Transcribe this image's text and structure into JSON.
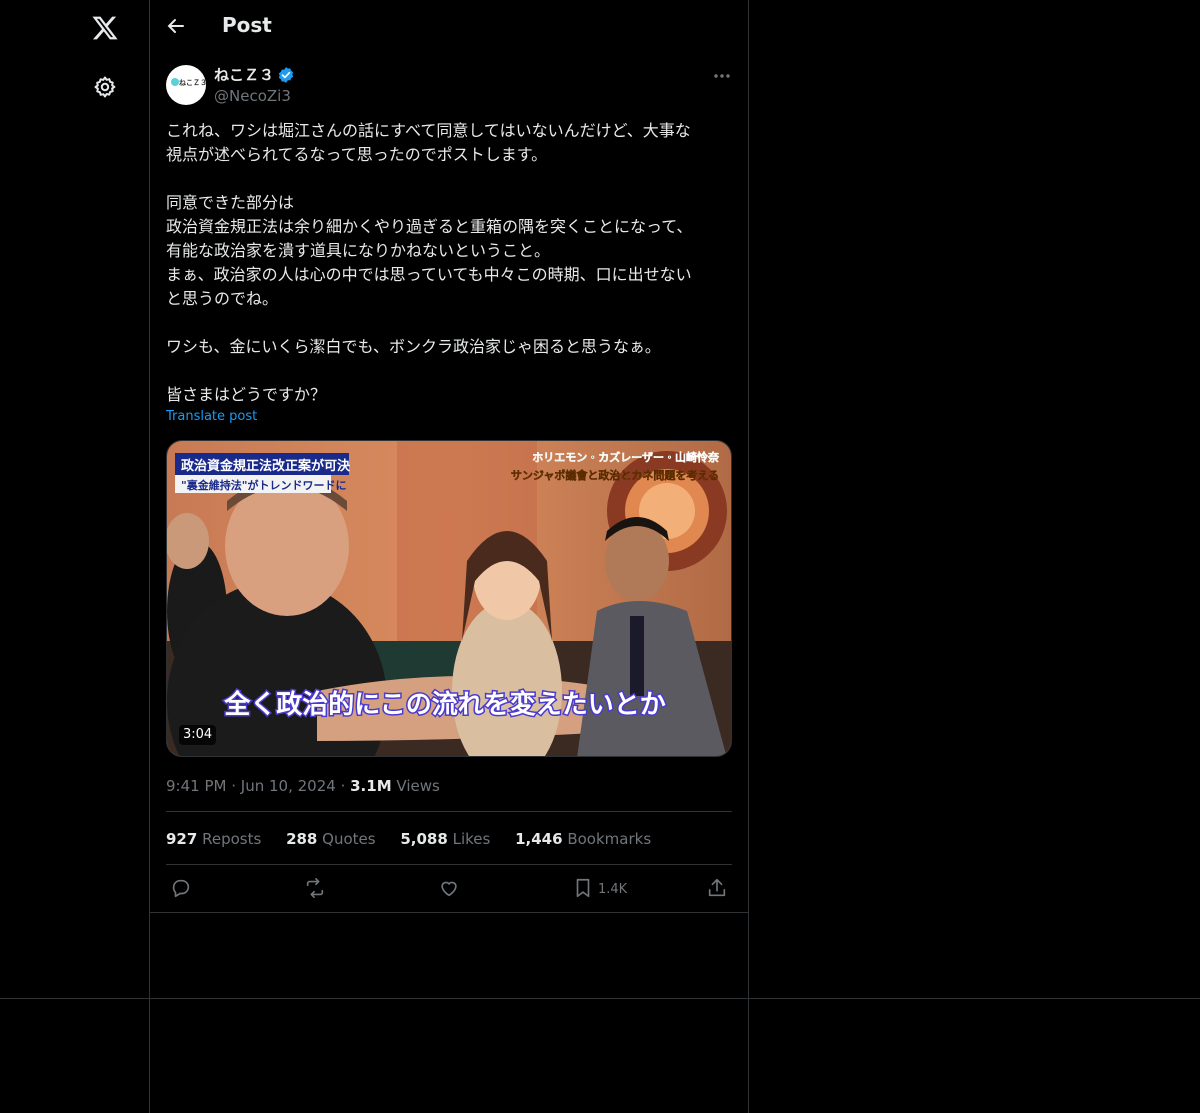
{
  "nav": {
    "logo_icon": "x-logo-icon",
    "settings_icon": "gear-icon"
  },
  "header": {
    "title": "Post",
    "back_icon": "arrow-left-icon"
  },
  "author": {
    "display_name": "ねこＺ３",
    "handle": "@NecoZi3",
    "avatar_text": "ねこＺ３",
    "verified": true
  },
  "post": {
    "text": "これね、ワシは堀江さんの話にすべて同意してはいないんだけど、大事な\n視点が述べられてるなって思ったのでポストします。\n\n同意できた部分は\n政治資金規正法は余り細かくやり過ぎると重箱の隅を突くことになって、\n有能な政治家を潰す道具になりかねないということ。\nまぁ、政治家の人は心の中では思っていても中々この時期、口に出せない\nと思うのでね。\n\nワシも、金にいくら潔白でも、ボンクラ政治家じゃ困ると思うなぁ。\n\n皆さまはどうですか？",
    "translate_label": "Translate post"
  },
  "media": {
    "caption_top_left_1": "政治資金規正法改正案が可決",
    "caption_top_left_2": "\"裏金維持法\"がトレンドワードに",
    "caption_top_right_1": "ホリエモン・カズレーザー・山崎怜奈",
    "caption_top_right_2": "サンジャポ議會と政治とカネ問題を考える",
    "subtitle": "全く政治的にこの流れを変えたいとか",
    "duration": "3:04"
  },
  "meta": {
    "time": "9:41 PM",
    "date": "Jun 10, 2024",
    "views_count": "3.1M",
    "views_label": "Views"
  },
  "stats": [
    {
      "count": "927",
      "label": "Reposts"
    },
    {
      "count": "288",
      "label": "Quotes"
    },
    {
      "count": "5,088",
      "label": "Likes"
    },
    {
      "count": "1,446",
      "label": "Bookmarks"
    }
  ],
  "actions": {
    "bookmark_count": "1.4K"
  },
  "colors": {
    "accent": "#1d9bf0",
    "border": "#2f3336",
    "muted": "#71767b"
  }
}
